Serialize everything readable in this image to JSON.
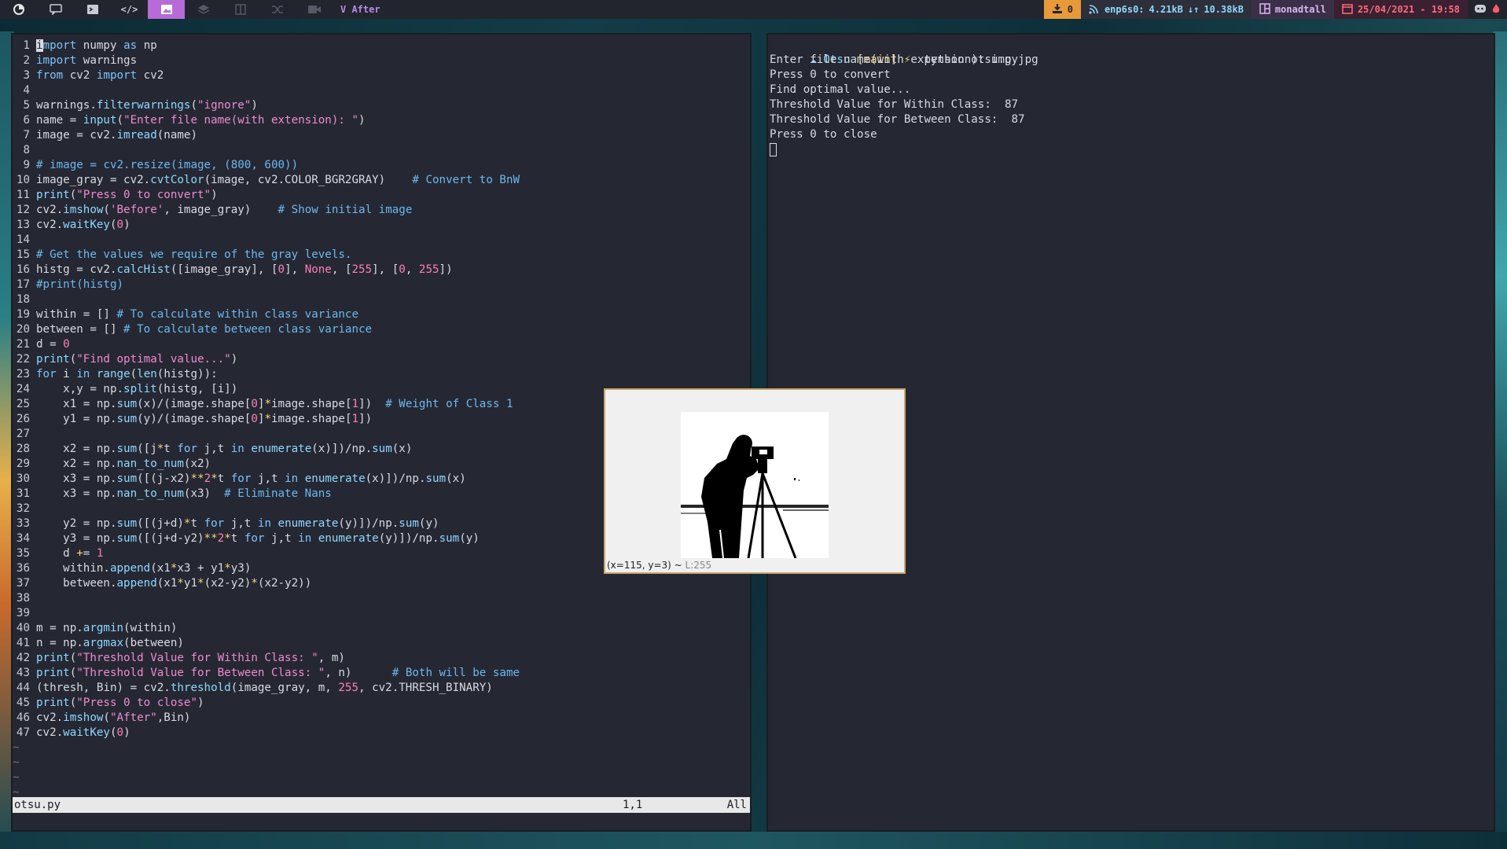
{
  "topbar": {
    "workspace_title": "V After",
    "workspaces": [
      "app-logo-icon",
      "chat-icon",
      "terminal-icon",
      "code-icon",
      "image-icon",
      "layers-icon",
      "book-icon",
      "shuffle-icon",
      "video-icon"
    ],
    "updates_count": "0",
    "network_iface": "enp6s0:",
    "net_up": "4.21kB",
    "net_down": "10.38kB",
    "layout_name": "monadtall",
    "datetime": "25/04/2021 - 19:58",
    "colors": {
      "active_ws": "#b66bd6",
      "updates_bg": "#e89a3b",
      "date_fg": "#ff6b7f"
    }
  },
  "editor": {
    "filename": "otsu.py",
    "position": "1,1",
    "scroll": "All",
    "lines": [
      {
        "n": "1",
        "t": "import numpy as np"
      },
      {
        "n": "2",
        "t": "import warnings"
      },
      {
        "n": "3",
        "t": "from cv2 import cv2"
      },
      {
        "n": "4",
        "t": ""
      },
      {
        "n": "5",
        "t": "warnings.filterwarnings(\"ignore\")"
      },
      {
        "n": "6",
        "t": "name = input(\"Enter file name(with extension): \")"
      },
      {
        "n": "7",
        "t": "image = cv2.imread(name)"
      },
      {
        "n": "8",
        "t": ""
      },
      {
        "n": "9",
        "t": "# image = cv2.resize(image, (800, 600))"
      },
      {
        "n": "10",
        "t": "image_gray = cv2.cvtColor(image, cv2.COLOR_BGR2GRAY)    # Convert to BnW"
      },
      {
        "n": "11",
        "t": "print(\"Press 0 to convert\")"
      },
      {
        "n": "12",
        "t": "cv2.imshow('Before', image_gray)    # Show initial image"
      },
      {
        "n": "13",
        "t": "cv2.waitKey(0)"
      },
      {
        "n": "14",
        "t": ""
      },
      {
        "n": "15",
        "t": "# Get the values we require of the gray levels."
      },
      {
        "n": "16",
        "t": "histg = cv2.calcHist([image_gray], [0], None, [255], [0, 255])"
      },
      {
        "n": "17",
        "t": "#print(histg)"
      },
      {
        "n": "18",
        "t": ""
      },
      {
        "n": "19",
        "t": "within = [] # To calculate within class variance"
      },
      {
        "n": "20",
        "t": "between = [] # To calculate between class variance"
      },
      {
        "n": "21",
        "t": "d = 0"
      },
      {
        "n": "22",
        "t": "print(\"Find optimal value...\")"
      },
      {
        "n": "23",
        "t": "for i in range(len(histg)):"
      },
      {
        "n": "24",
        "t": "    x,y = np.split(histg, [i])"
      },
      {
        "n": "25",
        "t": "    x1 = np.sum(x)/(image.shape[0]*image.shape[1])  # Weight of Class 1"
      },
      {
        "n": "26",
        "t": "    y1 = np.sum(y)/(image.shape[0]*image.shape[1])"
      },
      {
        "n": "27",
        "t": ""
      },
      {
        "n": "28",
        "t": "    x2 = np.sum([j*t for j,t in enumerate(x)])/np.sum(x)"
      },
      {
        "n": "29",
        "t": "    x2 = np.nan_to_num(x2)"
      },
      {
        "n": "30",
        "t": "    x3 = np.sum([(j-x2)**2*t for j,t in enumerate(x)])/np.sum(x)"
      },
      {
        "n": "31",
        "t": "    x3 = np.nan_to_num(x3)  # Eliminate Nans"
      },
      {
        "n": "32",
        "t": ""
      },
      {
        "n": "33",
        "t": "    y2 = np.sum([(j+d)*t for j,t in enumerate(y)])/np.sum(y)"
      },
      {
        "n": "34",
        "t": "    y3 = np.sum([(j+d-y2)**2*t for j,t in enumerate(y)])/np.sum(y)"
      },
      {
        "n": "35",
        "t": "    d += 1"
      },
      {
        "n": "36",
        "t": "    within.append(x1*x3 + y1*y3)"
      },
      {
        "n": "37",
        "t": "    between.append(x1*y1*(x2-y2)*(x2-y2))"
      },
      {
        "n": "38",
        "t": ""
      },
      {
        "n": "39",
        "t": ""
      },
      {
        "n": "40",
        "t": "m = np.argmin(within)"
      },
      {
        "n": "41",
        "t": "n = np.argmax(between)"
      },
      {
        "n": "42",
        "t": "print(\"Threshold Value for Within Class: \", m)"
      },
      {
        "n": "43",
        "t": "print(\"Threshold Value for Between Class: \", n)      # Both will be same"
      },
      {
        "n": "44",
        "t": "(thresh, Bin) = cv2.threshold(image_gray, m, 255, cv2.THRESH_BINARY)"
      },
      {
        "n": "45",
        "t": "print(\"Press 0 to close\")"
      },
      {
        "n": "46",
        "t": "cv2.imshow(\"After\",Bin)"
      },
      {
        "n": "47",
        "t": "cv2.waitKey(0)"
      }
    ],
    "empty_marker": "~",
    "empty_count": 4
  },
  "terminal": {
    "prompt_dir": "Otsu",
    "prompt_branch": "[main]",
    "prompt_symbol": "⚡",
    "command": "python otsu.py",
    "output": [
      "Enter file name(with extension): img.jpg",
      "Press 0 to convert",
      "Find optimal value...",
      "Threshold Value for Within Class:  87",
      "Threshold Value for Between Class:  87",
      "Press 0 to close"
    ]
  },
  "viewer": {
    "status_coords": "(x=115, y=3) ~",
    "status_lum": "L:255"
  }
}
